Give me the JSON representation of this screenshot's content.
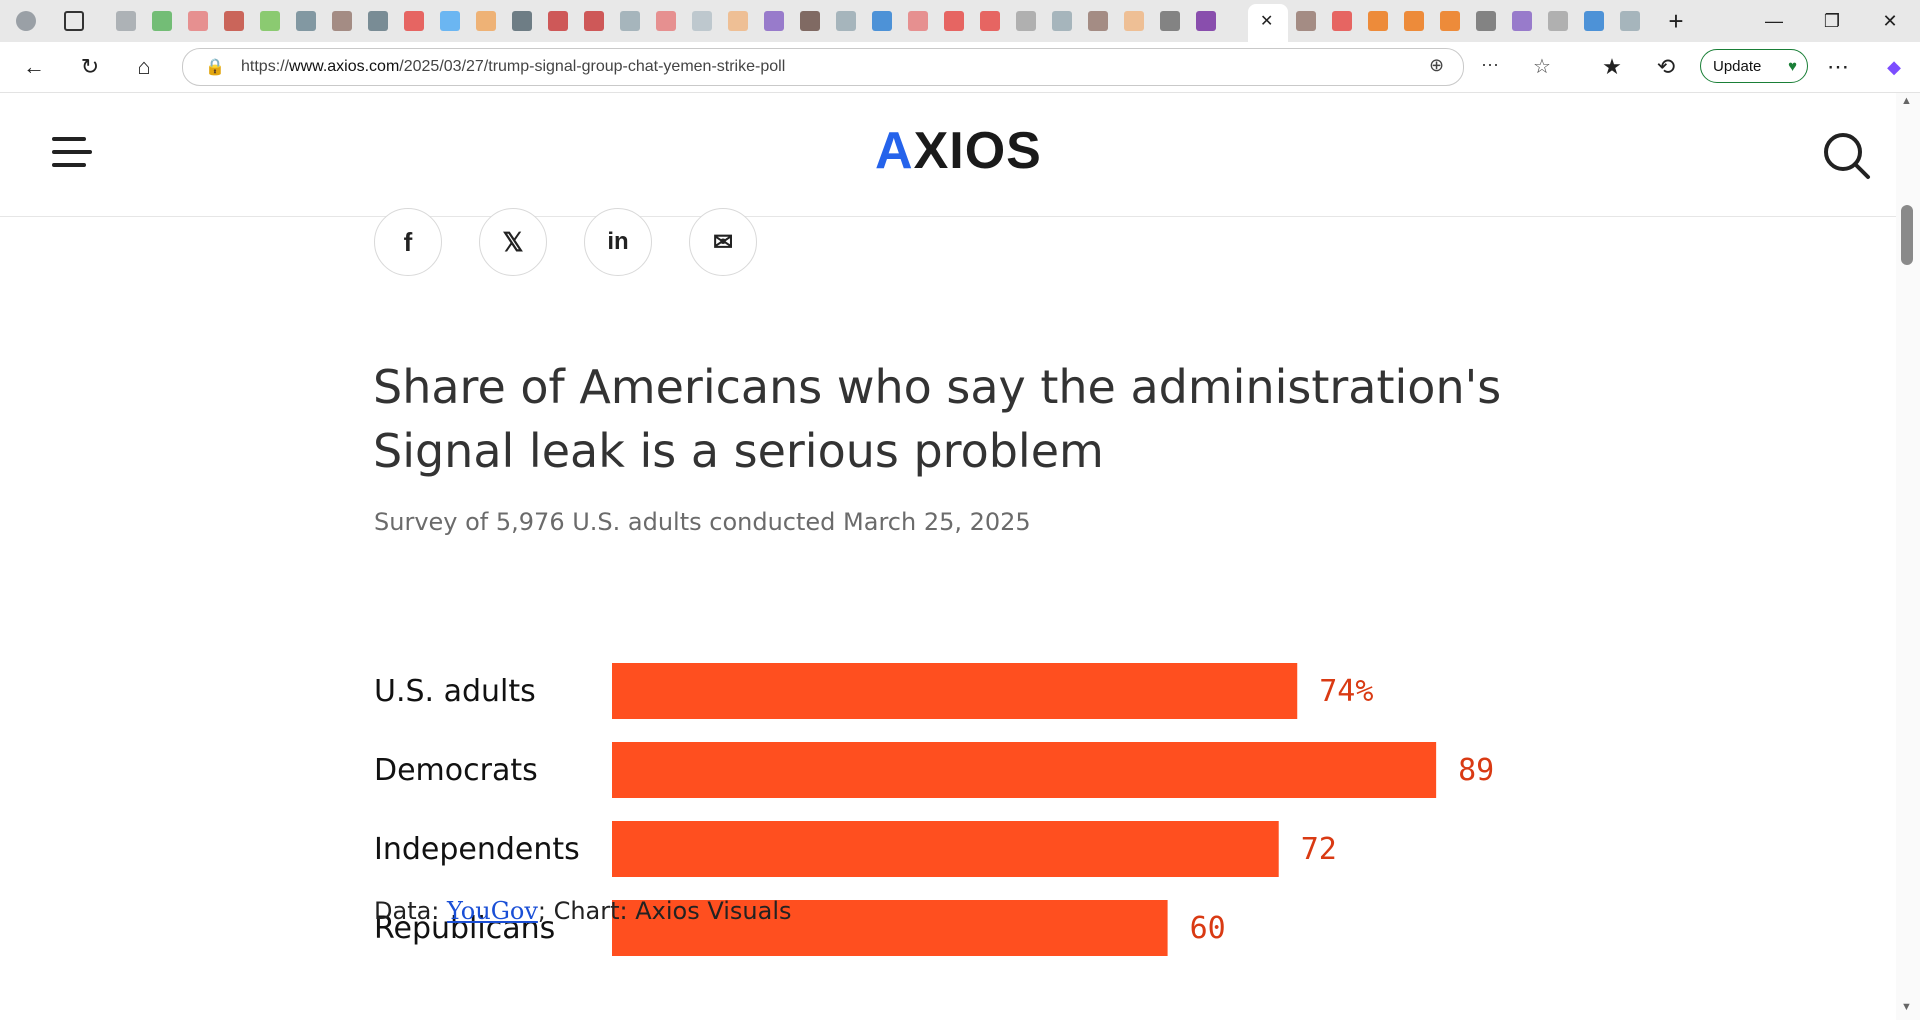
{
  "browser": {
    "url_prefix": "https://",
    "url_host": "www.axios.com",
    "url_path": "/2025/03/27/trump-signal-group-chat-yemen-strike-poll",
    "update_label": "Update"
  },
  "site": {
    "logo_text": "AXIOS"
  },
  "chart_data": {
    "type": "bar",
    "title": "Share of Americans who say the administration's Signal leak is a serious problem",
    "subtitle": "Survey of 5,976 U.S. adults conducted March 25, 2025",
    "categories": [
      "U.S. adults",
      "Democrats",
      "Independents",
      "Republicans"
    ],
    "values": [
      74,
      89,
      72,
      60
    ],
    "value_labels": [
      "74%",
      "89",
      "72",
      "60"
    ],
    "xlim": [
      0,
      100
    ],
    "bar_color": "#ff4f1f",
    "label_color": "#d93a13",
    "source_prefix": "Data: ",
    "source_link": "YouGov",
    "source_suffix": "; Chart: Axios Visuals"
  },
  "colors": {
    "accent": "#ff4f1f",
    "logo_blue": "#2563eb"
  }
}
